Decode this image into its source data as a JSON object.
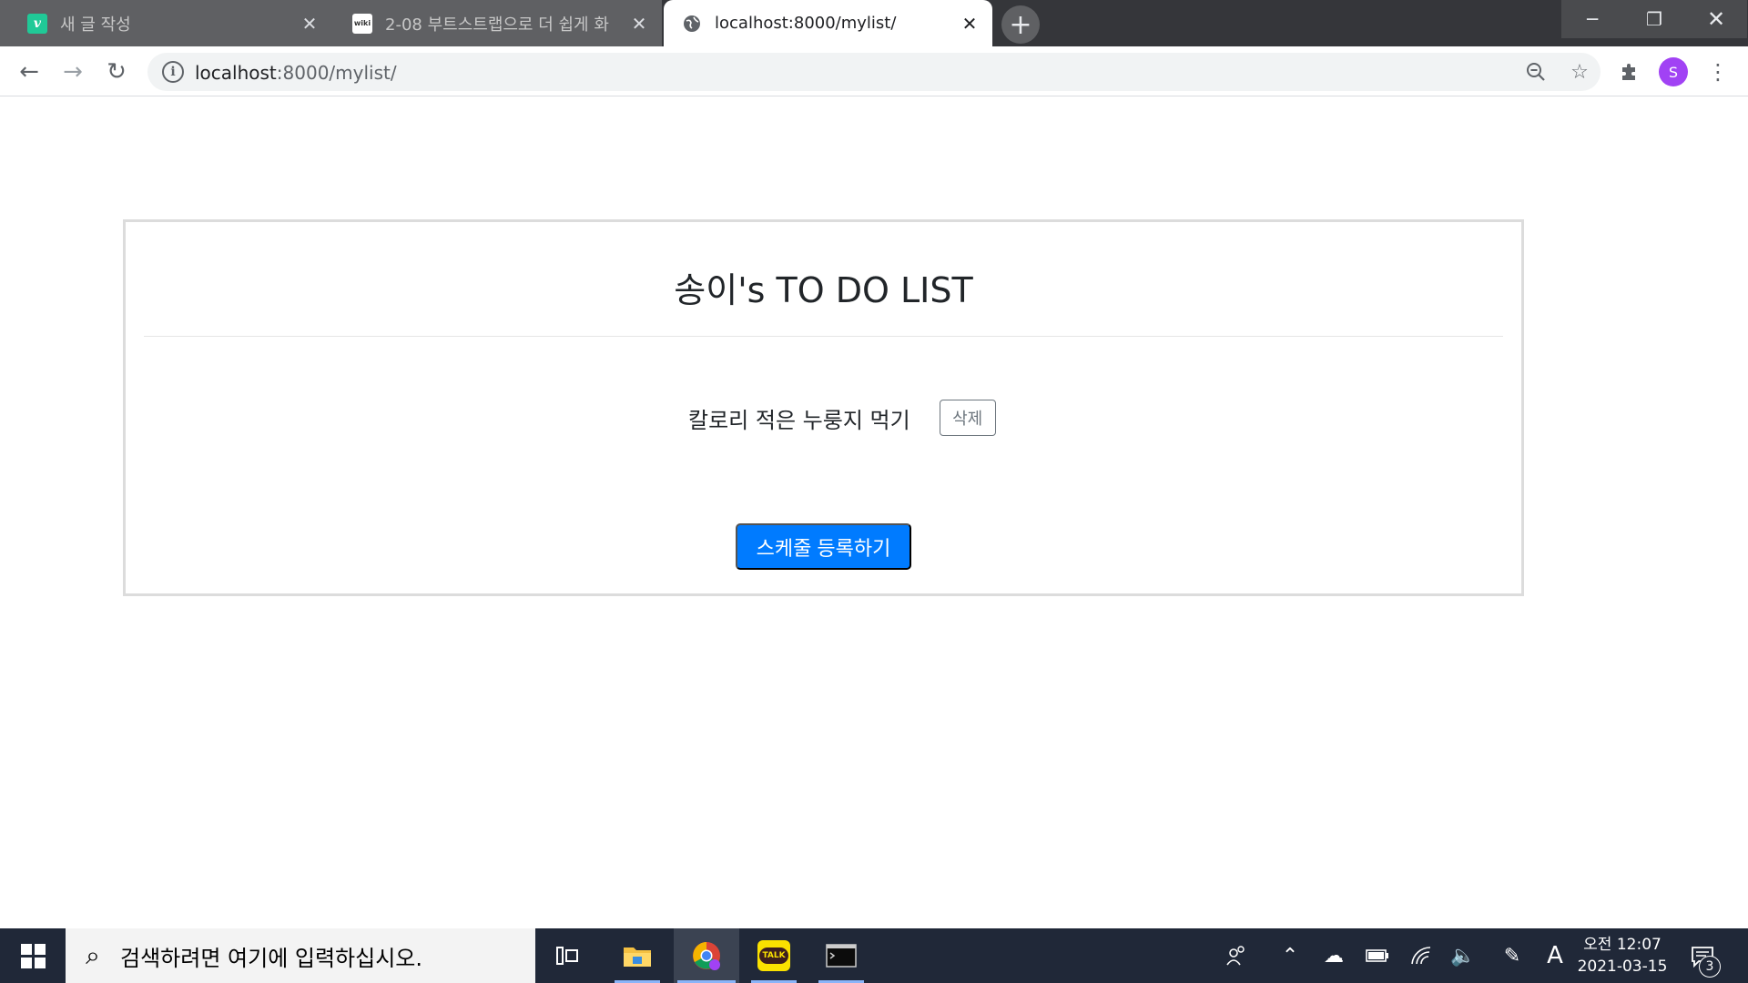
{
  "browser": {
    "tabs": [
      {
        "title": "새 글 작성",
        "favicon": "velog-icon",
        "active": false
      },
      {
        "title": "2-08 부트스트랩으로 더 쉽게 화",
        "favicon": "wikidocs-icon",
        "active": false
      },
      {
        "title": "localhost:8000/mylist/",
        "favicon": "globe-icon",
        "active": true
      }
    ],
    "favicon_text": {
      "velog": "v",
      "wikidocs": "wiki"
    },
    "address": {
      "host": "localhost",
      "rest": ":8000/mylist/"
    },
    "profile_initial": "S",
    "colors": {
      "tabstrip": "#35363a",
      "avatar": "#a142f4"
    }
  },
  "page": {
    "title": "송이's TO DO LIST",
    "items": [
      {
        "text": "칼로리 적은 누룽지 먹기",
        "delete_label": "삭제"
      }
    ],
    "register_button": "스케줄 등록하기",
    "colors": {
      "primary": "#007bff",
      "secondary": "#6c757d",
      "card_border": "#dcdcdc"
    }
  },
  "taskbar": {
    "search_placeholder": "검색하려면 여기에 입력하십시오.",
    "apps": [
      "task-view-icon",
      "file-explorer-icon",
      "chrome-icon",
      "kakaotalk-icon",
      "terminal-icon"
    ],
    "kakao_label": "TALK",
    "ime_indicator": "A",
    "time": "오전 12:07",
    "date": "2021-03-15",
    "notification_count": "3"
  }
}
